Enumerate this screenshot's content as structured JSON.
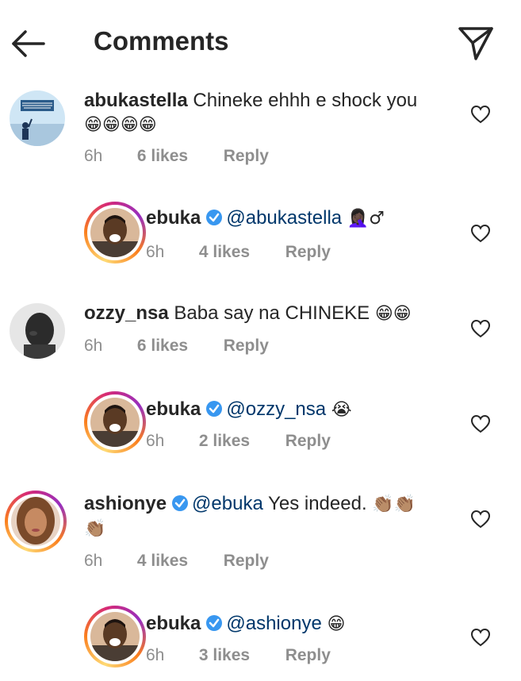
{
  "header": {
    "title": "Comments",
    "back_icon": "arrow-left-icon",
    "send_icon": "paper-plane-icon"
  },
  "comments": [
    {
      "username": "abukastella",
      "text": "Chineke ehhh e shock you",
      "emoji_line": "😁😁😁😁",
      "time": "6h",
      "likes": "6 likes",
      "reply": "Reply"
    },
    {
      "username": "ebuka",
      "verified": true,
      "mention": "@abukastella",
      "emoji": "🤦🏿‍♀️♂",
      "time": "6h",
      "likes": "4 likes",
      "reply": "Reply"
    },
    {
      "username": "ozzy_nsa",
      "text": "Baba say na CHINEKE",
      "emoji": "😁😁",
      "time": "6h",
      "likes": "6 likes",
      "reply": "Reply"
    },
    {
      "username": "ebuka",
      "verified": true,
      "mention": "@ozzy_nsa",
      "emoji": "😭",
      "time": "6h",
      "likes": "2 likes",
      "reply": "Reply"
    },
    {
      "username": "ashionye",
      "verified": true,
      "mention": "@ebuka",
      "text": "Yes indeed.",
      "emoji": "👏🏽👏🏽",
      "emoji_line": "👏🏽",
      "time": "6h",
      "likes": "4 likes",
      "reply": "Reply"
    },
    {
      "username": "ebuka",
      "verified": true,
      "mention": "@ashionye",
      "emoji": "😁",
      "time": "6h",
      "likes": "3 likes",
      "reply": "Reply"
    }
  ],
  "colors": {
    "accent_link": "#00376b",
    "verified_blue": "#3897f0",
    "meta_gray": "#8e8e8e"
  }
}
